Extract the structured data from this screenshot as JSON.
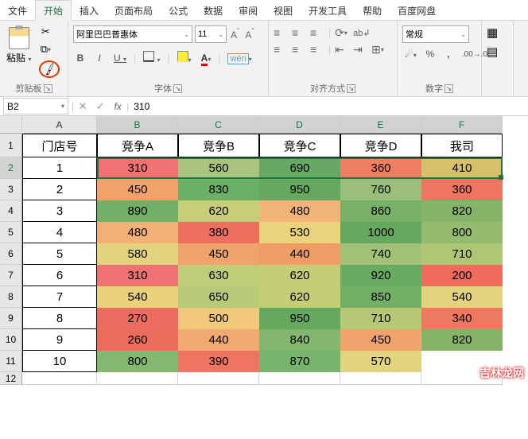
{
  "tabs": [
    "文件",
    "开始",
    "插入",
    "页面布局",
    "公式",
    "数据",
    "审阅",
    "视图",
    "开发工具",
    "帮助",
    "百度网盘"
  ],
  "active_tab": 1,
  "ribbon": {
    "clipboard": {
      "label": "剪贴板",
      "paste": "粘贴"
    },
    "font": {
      "label": "字体",
      "name": "阿里巴巴普惠体",
      "size": "11",
      "wen": "wén"
    },
    "align": {
      "label": "对齐方式"
    },
    "number": {
      "label": "数字",
      "format": "常规"
    }
  },
  "formula_bar": {
    "cell_ref": "B2",
    "value": "310"
  },
  "columns": [
    "A",
    "B",
    "C",
    "D",
    "E",
    "F"
  ],
  "row_numbers": [
    "1",
    "2",
    "3",
    "4",
    "5",
    "6",
    "7",
    "8",
    "9",
    "10",
    "11",
    "12"
  ],
  "headers": [
    "门店号",
    "竞争A",
    "竞争B",
    "竞争C",
    "竞争D",
    "我司"
  ],
  "chart_data": {
    "type": "table",
    "title": "",
    "columns": [
      "门店号",
      "竞争A",
      "竞争B",
      "竞争C",
      "竞争D",
      "我司"
    ],
    "rows": [
      {
        "门店号": "1",
        "竞争A": 310,
        "竞争B": 560,
        "竞争C": 690,
        "竞争D": 360,
        "我司": 410
      },
      {
        "门店号": "2",
        "竞争A": 450,
        "竞争B": 830,
        "竞争C": 950,
        "竞争D": 760,
        "我司": 360
      },
      {
        "门店号": "3",
        "竞争A": 890,
        "竞争B": 620,
        "竞争C": 480,
        "竞争D": 860,
        "我司": 820
      },
      {
        "门店号": "4",
        "竞争A": 480,
        "竞争B": 380,
        "竞争C": 530,
        "竞争D": 1000,
        "我司": 800
      },
      {
        "门店号": "5",
        "竞争A": 580,
        "竞争B": 450,
        "竞争C": 440,
        "竞争D": 740,
        "我司": 710
      },
      {
        "门店号": "6",
        "竞争A": 310,
        "竞争B": 630,
        "竞争C": 620,
        "竞争D": 920,
        "我司": 200
      },
      {
        "门店号": "7",
        "竞争A": 540,
        "竞争B": 650,
        "竞争C": 620,
        "竞争D": 850,
        "我司": 540
      },
      {
        "门店号": "8",
        "竞争A": 270,
        "竞争B": 500,
        "竞争C": 950,
        "竞争D": 710,
        "我司": 340
      },
      {
        "门店号": "9",
        "竞争A": 260,
        "竞争B": 440,
        "竞争C": 840,
        "竞争D": 450,
        "我司": 820
      },
      {
        "门店号": "10",
        "竞争A": 800,
        "竞争B": 390,
        "竞争C": 870,
        "竞争D": 570,
        "我司": ""
      }
    ]
  },
  "cell_colors": [
    [
      "#ee7272",
      "#a8c47c",
      "#66a964",
      "#ef7f62",
      "#d6c16a"
    ],
    [
      "#f3a369",
      "#6ab165",
      "#65a95e",
      "#99bf7a",
      "#ef7560"
    ],
    [
      "#72b067",
      "#c5cf78",
      "#f3b577",
      "#76b167",
      "#85b469"
    ],
    [
      "#f1b074",
      "#ee6f60",
      "#e9d47b",
      "#65a95e",
      "#95bb6e"
    ],
    [
      "#e3d37e",
      "#f0a46c",
      "#f09c66",
      "#a2c076",
      "#b1c675"
    ],
    [
      "#ee7272",
      "#c0cd77",
      "#c4ce76",
      "#68ac63",
      "#ef6b5c"
    ],
    [
      "#ead17c",
      "#b6ca77",
      "#c4ce76",
      "#73b066",
      "#e4d27c"
    ],
    [
      "#ed6c5f",
      "#f2c87a",
      "#65a95e",
      "#b4c876",
      "#ef795e"
    ],
    [
      "#ed6d5c",
      "#f1a970",
      "#83b76f",
      "#f0a46c",
      "#85b469"
    ],
    [
      "#84b86e",
      "#ef7560",
      "#77b56c",
      "#e2d37e",
      "#ffffff"
    ]
  ],
  "watermark": "吉林龙网"
}
